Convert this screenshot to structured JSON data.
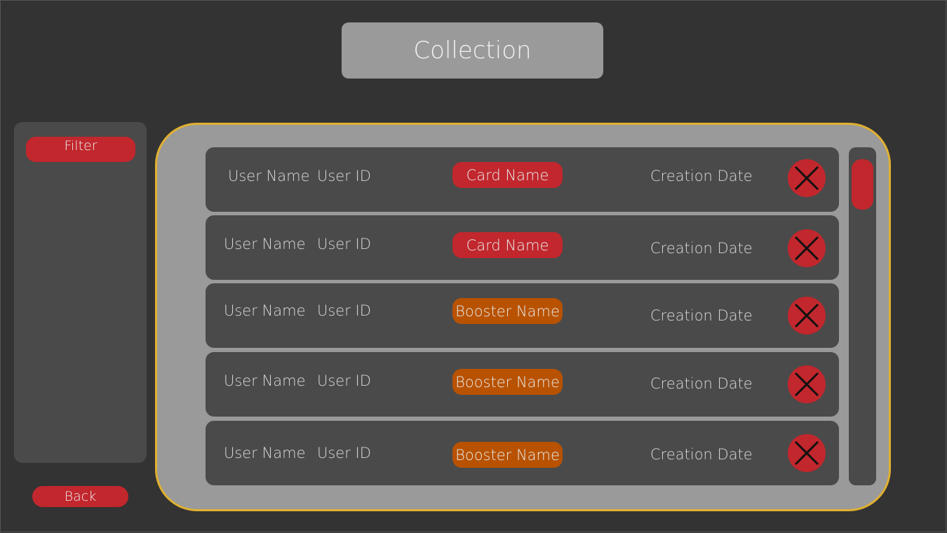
{
  "header": {
    "title": "Collection"
  },
  "sidebar": {
    "filter_label": "Filter",
    "back_label": "Back"
  },
  "rows": [
    {
      "user_name": "User Name",
      "user_id": "User ID",
      "item_name": "Card Name",
      "item_type": "card",
      "creation_date": "Creation Date",
      "delete_icon": "close-x-icon"
    },
    {
      "user_name": "User Name",
      "user_id": "User ID",
      "item_name": "Card Name",
      "item_type": "card",
      "creation_date": "Creation Date",
      "delete_icon": "close-x-icon"
    },
    {
      "user_name": "User Name",
      "user_id": "User ID",
      "item_name": "Booster Name",
      "item_type": "booster",
      "creation_date": "Creation Date",
      "delete_icon": "close-x-icon"
    },
    {
      "user_name": "User Name",
      "user_id": "User ID",
      "item_name": "Booster Name",
      "item_type": "booster",
      "creation_date": "Creation Date",
      "delete_icon": "close-x-icon"
    },
    {
      "user_name": "User Name",
      "user_id": "User ID",
      "item_name": "Booster Name",
      "item_type": "booster",
      "creation_date": "Creation Date",
      "delete_icon": "close-x-icon"
    }
  ],
  "colors": {
    "background": "#333333",
    "panel": "#9a9a9a",
    "panel_border": "#e0b030",
    "row": "#4a4a4a",
    "card_tag": "#c1272d",
    "booster_tag": "#b85200",
    "accent_red": "#c1272d"
  }
}
